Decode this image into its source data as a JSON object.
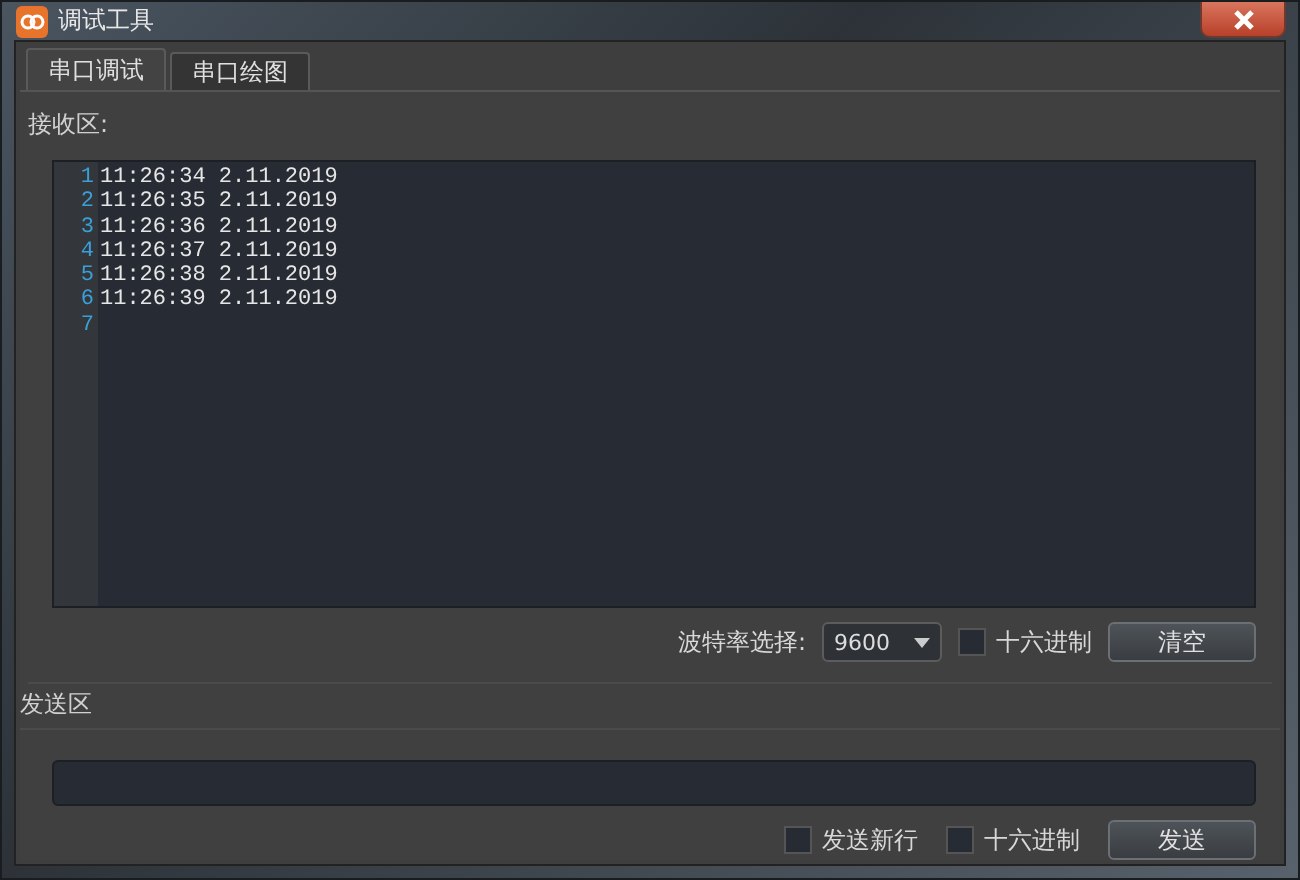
{
  "window": {
    "title": "调试工具"
  },
  "tabs": [
    {
      "label": "串口调试",
      "selected": true
    },
    {
      "label": "串口绘图",
      "selected": false
    }
  ],
  "receive": {
    "label": "接收区:",
    "lines": [
      {
        "number": "1",
        "text": "11:26:34 2.11.2019"
      },
      {
        "number": "2",
        "text": "11:26:35 2.11.2019"
      },
      {
        "number": "3",
        "text": "11:26:36 2.11.2019"
      },
      {
        "number": "4",
        "text": "11:26:37 2.11.2019"
      },
      {
        "number": "5",
        "text": "11:26:38 2.11.2019"
      },
      {
        "number": "6",
        "text": "11:26:39 2.11.2019"
      },
      {
        "number": "7"
      }
    ],
    "baud_label": "波特率选择:",
    "baud_value": "9600",
    "hex": {
      "label": "十六进制",
      "checked": false
    },
    "clear_button": "清空"
  },
  "send": {
    "label": "发送区",
    "newline": {
      "label": "发送新行",
      "checked": false
    },
    "hex": {
      "label": "十六进制",
      "checked": false
    },
    "send_button": "发送"
  }
}
